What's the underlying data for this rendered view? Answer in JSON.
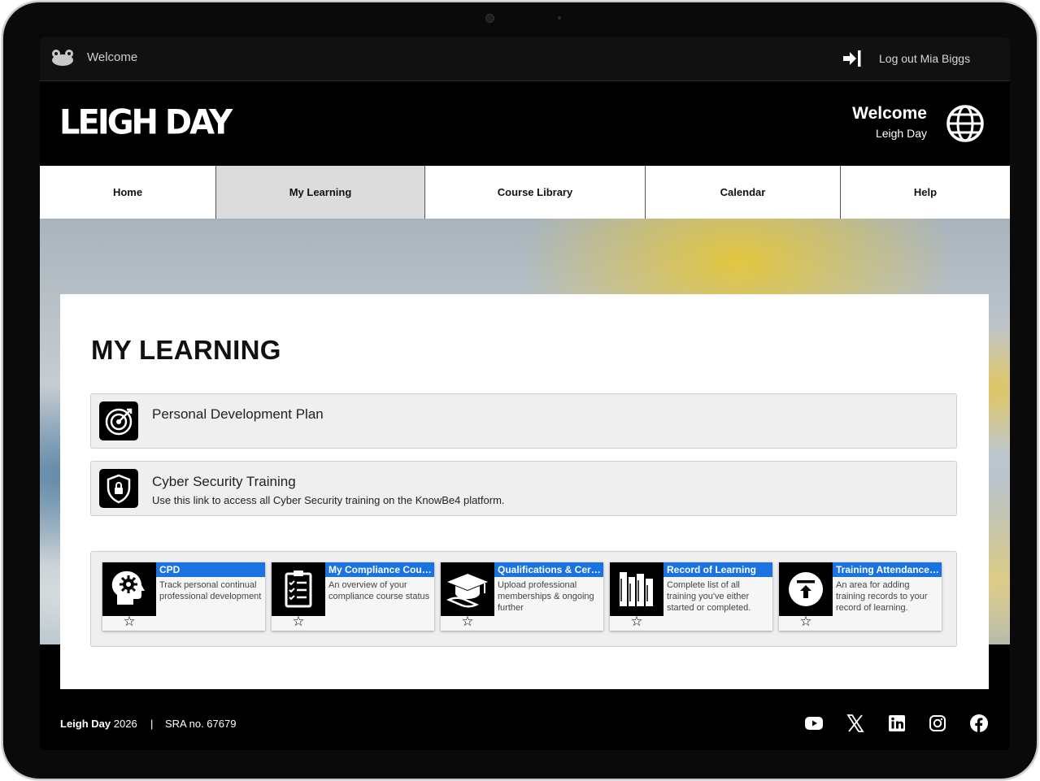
{
  "topbar": {
    "welcome_label": "Welcome",
    "logout_label": "Log out Mia Biggs"
  },
  "header": {
    "logo_text": "LEIGH DAY",
    "welcome_title": "Welcome",
    "welcome_org": "Leigh Day"
  },
  "nav": {
    "items": [
      {
        "label": "Home",
        "active": false
      },
      {
        "label": "My Learning",
        "active": true
      },
      {
        "label": "Course Library",
        "active": false
      },
      {
        "label": "Calendar",
        "active": false
      },
      {
        "label": "Help",
        "active": false
      }
    ]
  },
  "main": {
    "title": "MY LEARNING",
    "links": [
      {
        "title": "Personal Development Plan",
        "subtitle": "",
        "icon": "target-icon"
      },
      {
        "title": "Cyber Security Training",
        "subtitle": "Use this link to access all Cyber Security training on the KnowBe4 platform.",
        "icon": "shield-lock-icon"
      }
    ],
    "tiles": [
      {
        "title": "CPD",
        "desc": "Track personal continual professional development",
        "icon": "head-gear-icon"
      },
      {
        "title": "My Compliance Courses",
        "desc": "An overview of your compliance course status",
        "icon": "checklist-icon"
      },
      {
        "title": "Qualifications & Certifications",
        "desc": "Upload professional memberships & ongoing further",
        "icon": "graduation-cap-icon"
      },
      {
        "title": "Record of Learning",
        "desc": "Complete list of all training you've either started or completed.",
        "icon": "bookshelf-icon"
      },
      {
        "title": "Training Attendance Sheets",
        "desc": "An area for adding training records to your record of learning.",
        "icon": "upload-icon"
      }
    ]
  },
  "footer": {
    "brand": "Leigh Day",
    "year": "2026",
    "separator": "|",
    "sra": "SRA no. 67679",
    "social": [
      "youtube-icon",
      "x-icon",
      "linkedin-icon",
      "instagram-icon",
      "facebook-icon"
    ]
  },
  "colors": {
    "accent": "#1a73e0",
    "nav_active": "#dcdcdc",
    "background": "#000000"
  }
}
